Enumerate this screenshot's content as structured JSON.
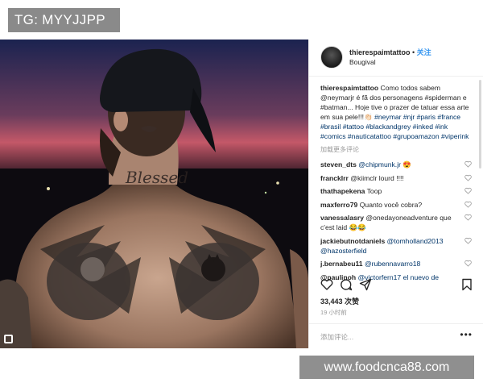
{
  "overlay": {
    "tg_label": "TG: MYYJJPP",
    "watermark": "www.foodcnca88.com"
  },
  "photo": {
    "tattoo_text": "Blessed"
  },
  "header": {
    "username": "thierespaimtattoo",
    "separator": " • ",
    "follow_label": "关注",
    "location": "Bougival"
  },
  "caption": {
    "username": "thierespaimtattoo",
    "text": "Como todos sabem @neymarjr é fã dos personagens #spiderman e #batman... Hoje tive o prazer de tatuar essa arte em sua pele!!!👏🏻",
    "hashtags": "#neymar #njr #paris #france #brasil #tattoo #blackandgrey #inked #ink #comics #nauticatattoo #grupoamazon #viperink"
  },
  "load_more_label": "加载更多评论",
  "comments": [
    {
      "user": "steven_dts",
      "text": "@chipmunk.jr 😍"
    },
    {
      "user": "franckIrr",
      "text": "@kiimclr lourd !!!!"
    },
    {
      "user": "thathapekena",
      "text": "Toop"
    },
    {
      "user": "maxferro79",
      "text": "Quanto você cobra?"
    },
    {
      "user": "vanessalasry",
      "text": "@onedayoneadventure que c'est laid 😂😂"
    },
    {
      "user": "jackiebutnotdaniels",
      "text": "@tomholland2013 @hazosterfield"
    },
    {
      "user": "j.bernabeu11",
      "text": "@rubennavarro18"
    },
    {
      "user": "@paulinoh",
      "text": "@victorfern17 el nuevo de"
    }
  ],
  "stats": {
    "likes": "33,443 次赞",
    "time": "19 小时前"
  },
  "add_comment": {
    "placeholder": "添加评论...",
    "more_label": "•••"
  },
  "icons": {
    "heart": "heart-icon",
    "comment": "comment-icon",
    "share": "share-icon",
    "bookmark": "bookmark-icon",
    "heart_small": "small-heart-icon",
    "corner": "square-icon"
  },
  "colors": {
    "link": "#003569",
    "follow": "#3897f0",
    "muted": "#999999",
    "text": "#262626"
  }
}
